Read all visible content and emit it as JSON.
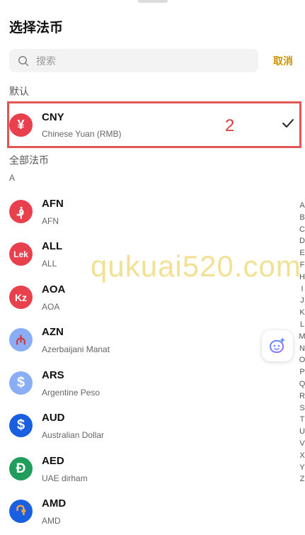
{
  "header": {
    "title": "选择法币"
  },
  "search": {
    "placeholder": "搜索",
    "cancel_label": "取消"
  },
  "default_section": {
    "label": "默认",
    "item": {
      "code": "CNY",
      "name": "Chinese Yuan (RMB)",
      "symbol": "¥",
      "color": "#e8414d",
      "selected": true
    }
  },
  "annotation_number": "2",
  "all_section": {
    "label": "全部法币",
    "letter": "A"
  },
  "currencies": [
    {
      "code": "AFN",
      "name": "AFN",
      "symbol": "؋",
      "color": "#e8414d"
    },
    {
      "code": "ALL",
      "name": "ALL",
      "symbol": "Lek",
      "color": "#e8414d"
    },
    {
      "code": "AOA",
      "name": "AOA",
      "symbol": "Kz",
      "color": "#e8414d"
    },
    {
      "code": "AZN",
      "name": "Azerbaijani Manat",
      "symbol": "₼",
      "color": "#8aaef5"
    },
    {
      "code": "ARS",
      "name": "Argentine Peso",
      "symbol": "$",
      "color": "#8aaef5"
    },
    {
      "code": "AUD",
      "name": "Australian Dollar",
      "symbol": "$",
      "color": "#1a5fe0"
    },
    {
      "code": "AED",
      "name": "UAE dirham",
      "symbol": "Đ",
      "color": "#1f9d5a"
    },
    {
      "code": "AMD",
      "name": "AMD",
      "symbol": "֏",
      "color": "#1a5fe0"
    }
  ],
  "alphabet": [
    "A",
    "B",
    "C",
    "D",
    "E",
    "F",
    "H",
    "I",
    "J",
    "K",
    "L",
    "M",
    "N",
    "O",
    "P",
    "Q",
    "R",
    "S",
    "T",
    "U",
    "V",
    "X",
    "Y",
    "Z"
  ],
  "watermark": "qukuai520.com",
  "icons": {
    "search": "search-icon",
    "check": "checkmark-icon",
    "assistant": "ai-assistant-icon"
  }
}
